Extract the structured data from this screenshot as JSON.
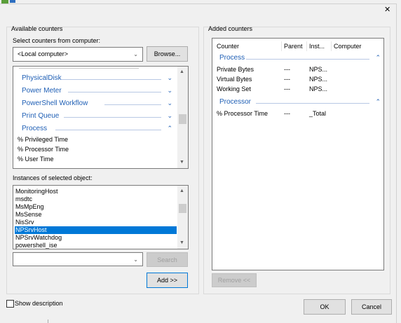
{
  "window": {
    "close_glyph": "✕"
  },
  "available": {
    "group_label": "Available counters",
    "select_label": "Select counters from computer:",
    "computer_value": "<Local computer>",
    "browse_label": "Browse...",
    "categories": [
      {
        "label": "PhysicalDisk",
        "chevron": "⌄"
      },
      {
        "label": "Power Meter",
        "chevron": "⌄"
      },
      {
        "label": "PowerShell Workflow",
        "chevron": "⌄"
      },
      {
        "label": "Print Queue",
        "chevron": "⌄"
      },
      {
        "label": "Process",
        "chevron": "⌃"
      }
    ],
    "counters": [
      "% Privileged Time",
      "% Processor Time",
      "% User Time"
    ],
    "instances_label": "Instances of selected object:",
    "instances": [
      "MonitoringHost",
      "msdtc",
      "MsMpEng",
      "MsSense",
      "NisSrv",
      "NPSrvHost",
      "NPSrvWatchdog",
      "powershell_ise"
    ],
    "selected_instance": "NPSrvHost",
    "search_value": "",
    "search_label": "Search",
    "add_label": "Add >>"
  },
  "added": {
    "group_label": "Added counters",
    "columns": [
      "Counter",
      "Parent",
      "Inst...",
      "Computer"
    ],
    "groups": [
      {
        "name": "Process",
        "chevron": "⌃",
        "rows": [
          {
            "counter": "Private Bytes",
            "parent": "---",
            "instance": "NPS..."
          },
          {
            "counter": "Virtual Bytes",
            "parent": "---",
            "instance": "NPS..."
          },
          {
            "counter": "Working Set",
            "parent": "---",
            "instance": "NPS..."
          }
        ]
      },
      {
        "name": "Processor",
        "chevron": "⌃",
        "rows": [
          {
            "counter": "% Processor Time",
            "parent": "---",
            "instance": "_Total"
          }
        ]
      }
    ],
    "remove_label": "Remove <<"
  },
  "footer": {
    "show_description_label": "Show description",
    "ok_label": "OK",
    "cancel_label": "Cancel"
  }
}
